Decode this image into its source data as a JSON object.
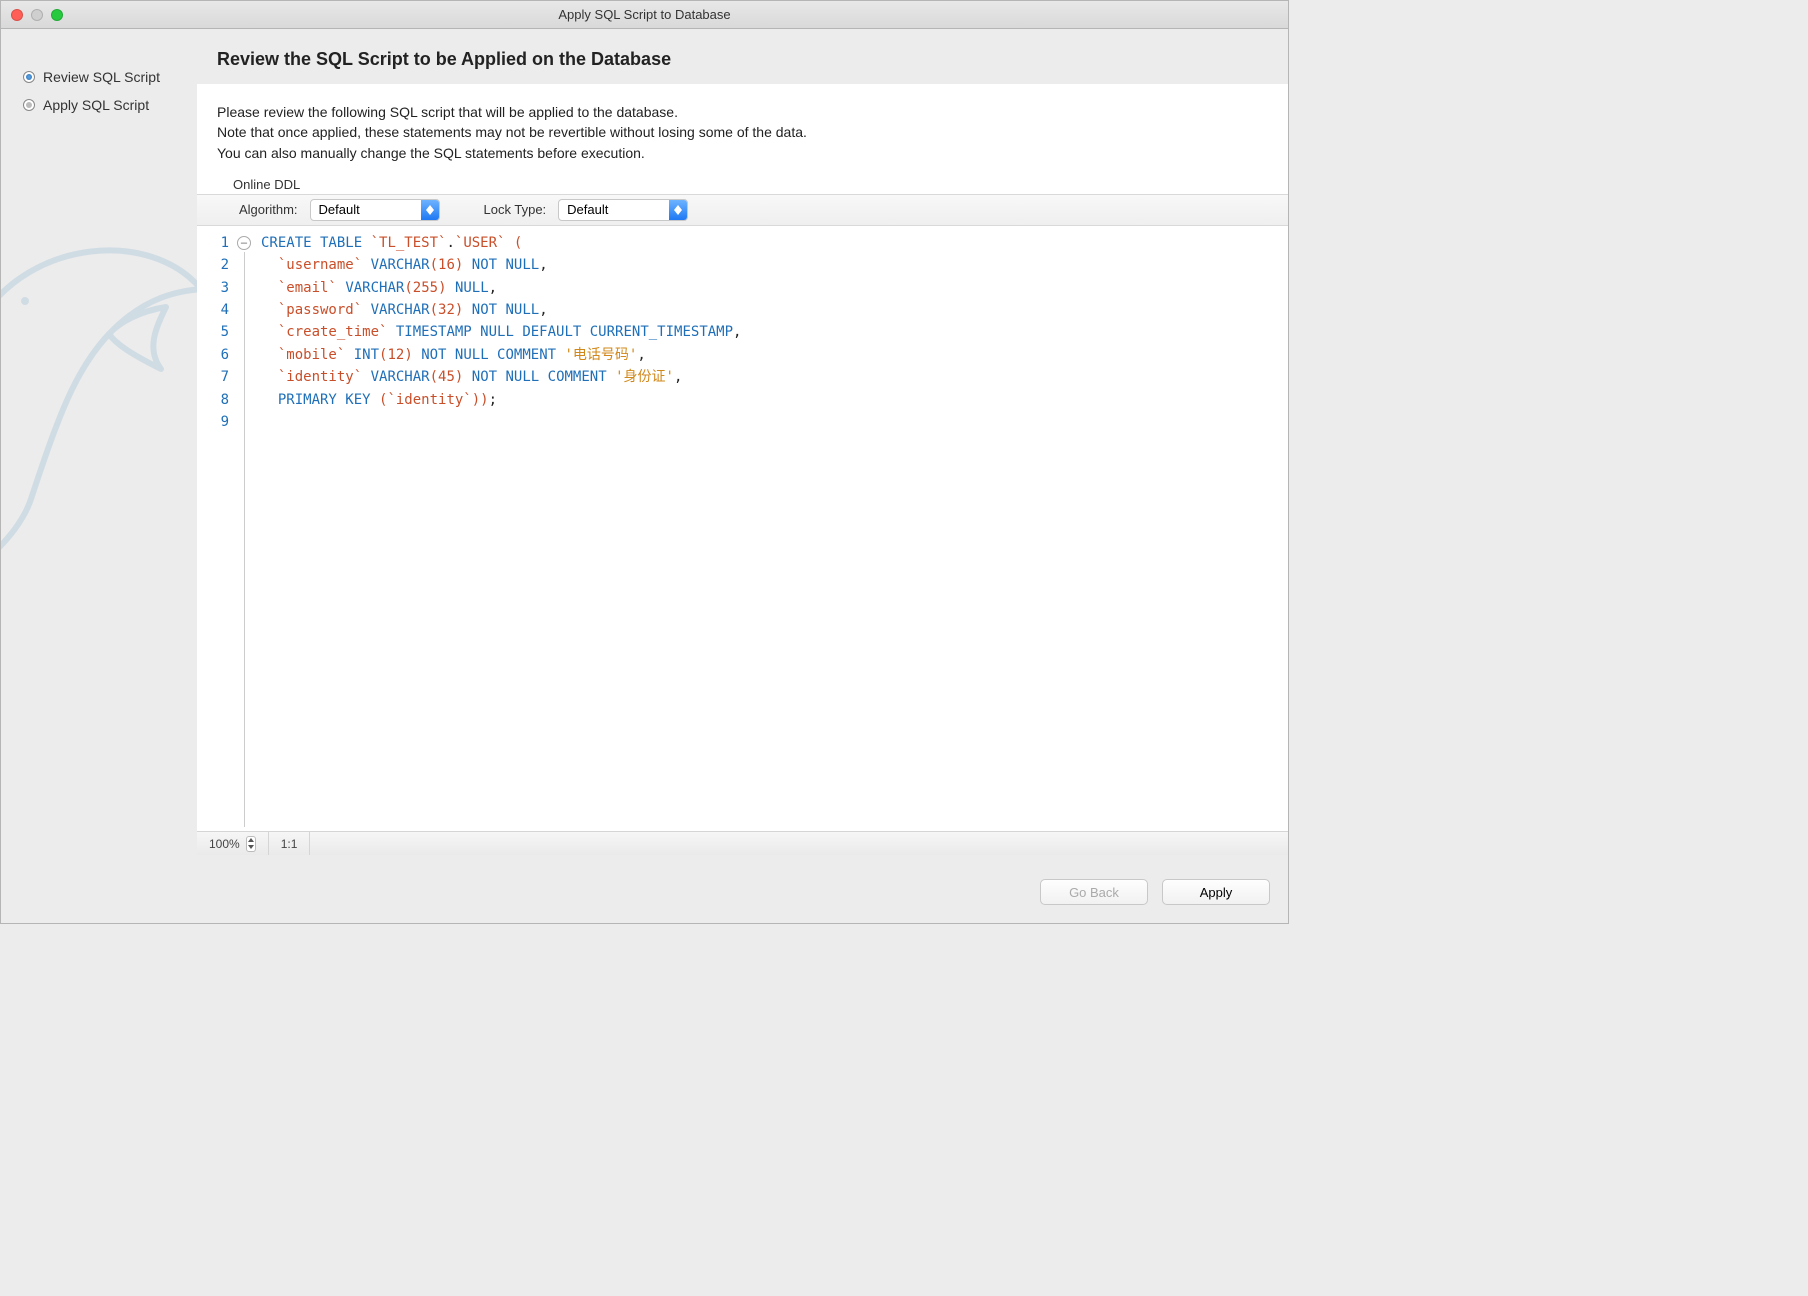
{
  "window": {
    "title": "Apply SQL Script to Database"
  },
  "sidebar": {
    "steps": [
      {
        "label": "Review SQL Script",
        "active": true
      },
      {
        "label": "Apply SQL Script",
        "active": false
      }
    ]
  },
  "main": {
    "heading": "Review the SQL Script to be Applied on the Database",
    "instructions": {
      "line1": "Please review the following SQL script that will be applied to the database.",
      "line2": "Note that once applied, these statements may not be revertible without losing some of the data.",
      "line3": "You can also manually change the SQL statements before execution."
    },
    "online_ddl": {
      "section_label": "Online DDL",
      "algorithm_label": "Algorithm:",
      "algorithm_value": "Default",
      "lock_label": "Lock Type:",
      "lock_value": "Default"
    },
    "code_lines": [
      "1",
      "2",
      "3",
      "4",
      "5",
      "6",
      "7",
      "8",
      "9"
    ],
    "sql": {
      "schema": "TL_TEST",
      "table": "USER",
      "columns": [
        {
          "name": "username",
          "type": "VARCHAR",
          "len": "16",
          "extra": "NOT NULL"
        },
        {
          "name": "email",
          "type": "VARCHAR",
          "len": "255",
          "extra": "NULL"
        },
        {
          "name": "password",
          "type": "VARCHAR",
          "len": "32",
          "extra": "NOT NULL"
        },
        {
          "name": "create_time",
          "type": "TIMESTAMP",
          "len": "",
          "extra": "NULL DEFAULT CURRENT_TIMESTAMP"
        },
        {
          "name": "mobile",
          "type": "INT",
          "len": "12",
          "extra": "NOT NULL COMMENT",
          "comment": "电话号码"
        },
        {
          "name": "identity",
          "type": "VARCHAR",
          "len": "45",
          "extra": "NOT NULL COMMENT",
          "comment": "身份证"
        }
      ],
      "primary_key": "identity"
    },
    "status": {
      "zoom": "100%",
      "ratio": "1:1"
    }
  },
  "footer": {
    "back_label": "Go Back",
    "apply_label": "Apply"
  }
}
